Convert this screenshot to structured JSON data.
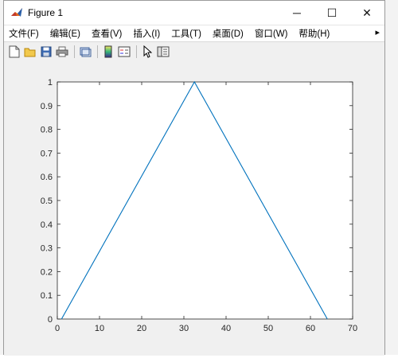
{
  "window": {
    "title": "Figure 1",
    "controls": {
      "minimize": "─",
      "maximize": "☐",
      "close": "✕"
    }
  },
  "menu": {
    "items": [
      "文件(F)",
      "编辑(E)",
      "查看(V)",
      "插入(I)",
      "工具(T)",
      "桌面(D)",
      "窗口(W)",
      "帮助(H)"
    ],
    "overflow": "▸"
  },
  "toolbar": {
    "buttons": [
      "new-figure-icon",
      "open-file-icon",
      "save-icon",
      "print-icon",
      "link-plot-icon",
      "insert-colorbar-icon",
      "insert-legend-icon",
      "edit-plot-icon",
      "property-inspector-icon"
    ]
  },
  "colors": {
    "line": "#0072bd",
    "axes": "#262626"
  },
  "chart_data": {
    "type": "line",
    "x": [
      1,
      32.5,
      64
    ],
    "y": [
      0,
      1,
      0
    ],
    "xlim": [
      0,
      70
    ],
    "ylim": [
      0,
      1
    ],
    "xticks": [
      "0",
      "10",
      "20",
      "30",
      "40",
      "50",
      "60",
      "70"
    ],
    "yticks": [
      "0",
      "0.1",
      "0.2",
      "0.3",
      "0.4",
      "0.5",
      "0.6",
      "0.7",
      "0.8",
      "0.9",
      "1"
    ],
    "grid": false,
    "title": "",
    "xlabel": "",
    "ylabel": ""
  }
}
